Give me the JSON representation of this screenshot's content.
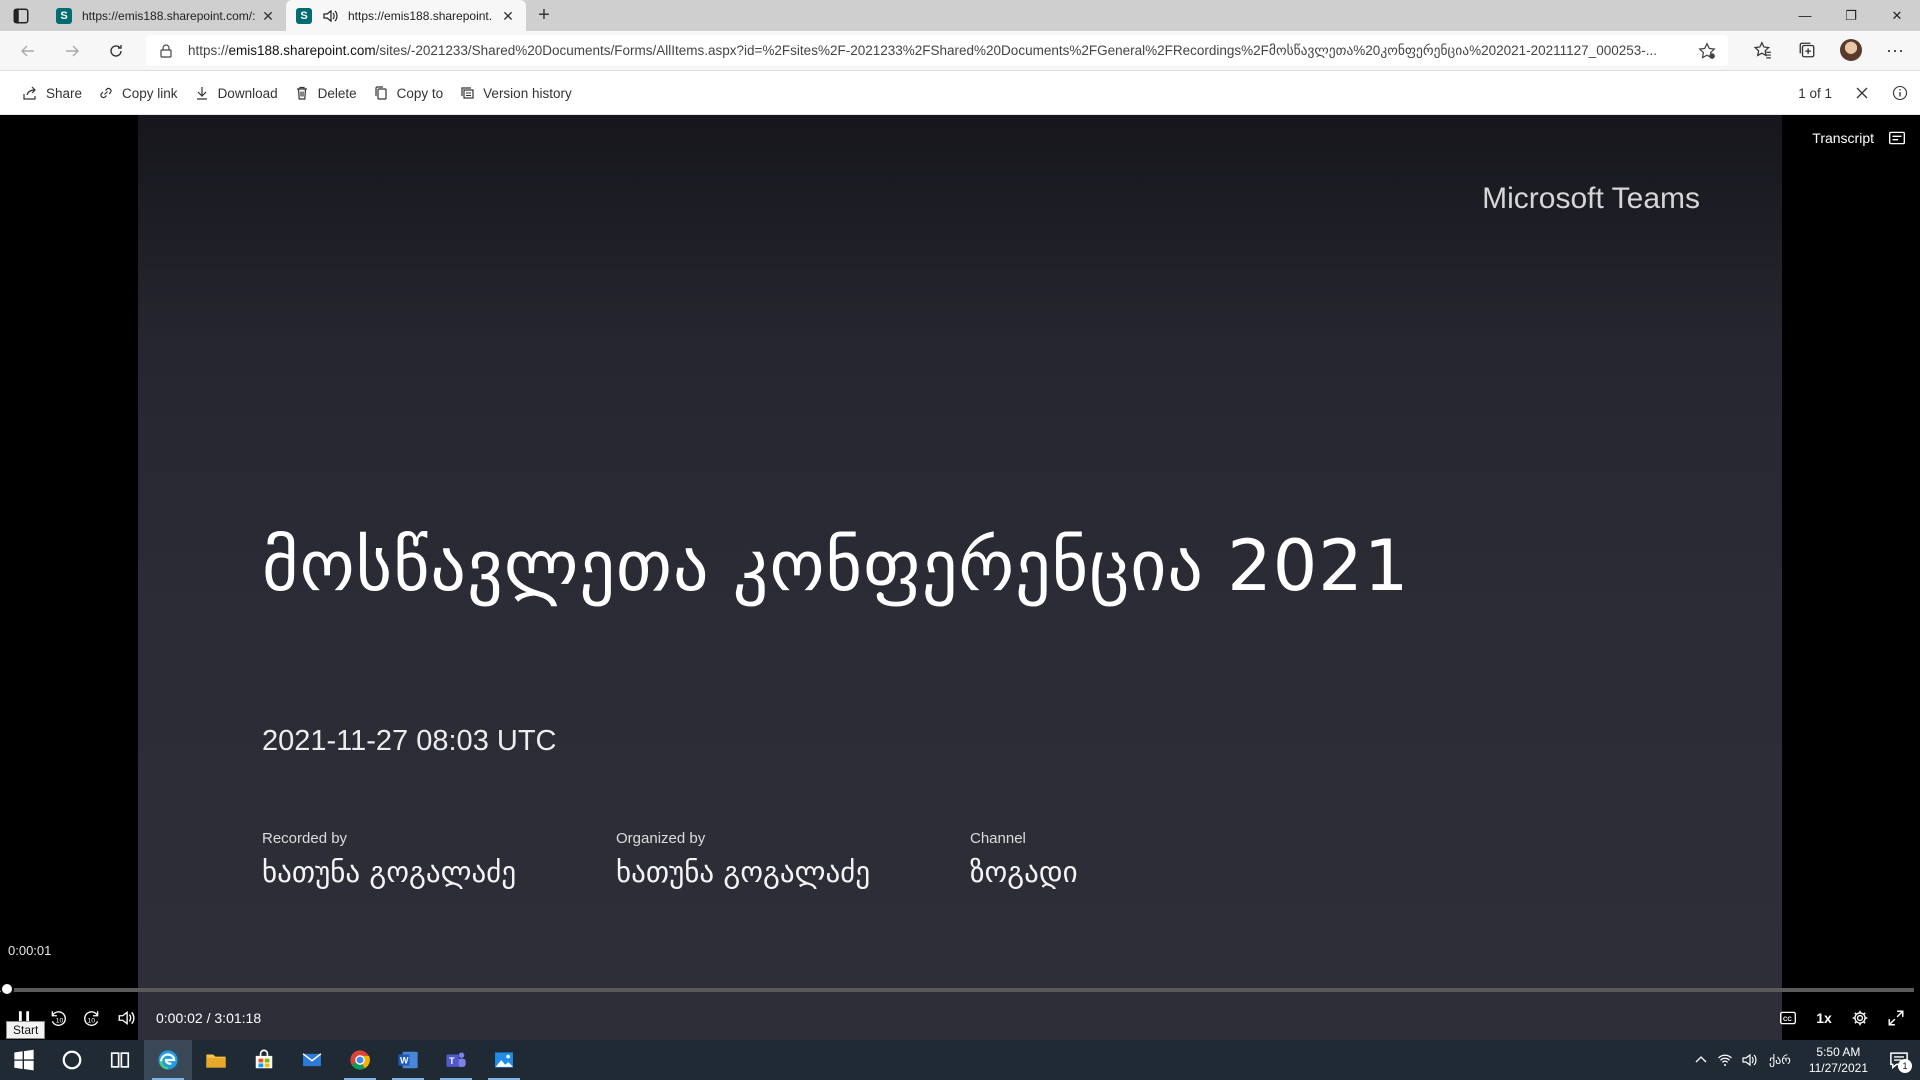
{
  "browser": {
    "tabs": [
      {
        "title": "https://emis188.sharepoint.com/:",
        "favicon": "S",
        "active": false
      },
      {
        "title": "https://emis188.sharepoint.",
        "favicon": "S",
        "active": true
      }
    ],
    "url_domain": "emis188.sharepoint.com",
    "url_prefix": "https://",
    "url_rest": "/sites/-2021233/Shared%20Documents/Forms/AllItems.aspx?id=%2Fsites%2F-2021233%2FShared%20Documents%2FGeneral%2FRecordings%2Fმოსწავლეთა%20კონფერენცია%202021-20211127_000253-..."
  },
  "commandbar": {
    "share": "Share",
    "copy_link": "Copy link",
    "download": "Download",
    "delete": "Delete",
    "copy_to": "Copy to",
    "version_history": "Version history",
    "page_count": "1 of 1"
  },
  "slide": {
    "brand": "Microsoft Teams",
    "title": "მოსწავლეთა კონფერენცია 2021",
    "date": "2021-11-27 08:03 UTC",
    "recorded_by_label": "Recorded by",
    "recorded_by": "ხათუნა გოგალაძე",
    "organized_by_label": "Organized by",
    "organized_by": "ხათუნა გოგალაძე",
    "channel_label": "Channel",
    "channel": "ზოგადი"
  },
  "player": {
    "transcript_label": "Transcript",
    "hover_time": "0:00:01",
    "current_time": "0:00:02",
    "separator": "/",
    "duration": "3:01:18",
    "progress_fraction": 0.0002,
    "speed": "1x",
    "tooltip": "Start"
  },
  "taskbar": {
    "language": "ქარ",
    "time": "5:50 AM",
    "date": "11/27/2021",
    "notification_count": "1"
  }
}
